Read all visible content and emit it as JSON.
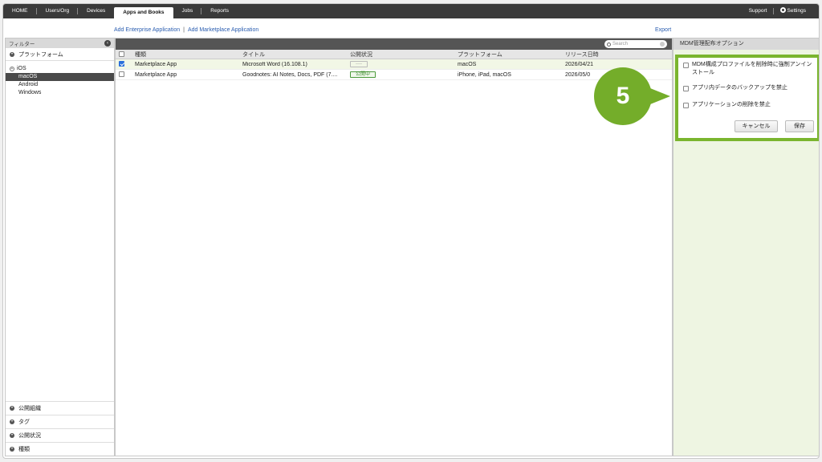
{
  "nav": {
    "items": [
      "HOME",
      "Users/Org",
      "Devices",
      "Apps and Books",
      "Jobs",
      "Reports"
    ],
    "support": "Support",
    "settings": "Settings"
  },
  "actions": {
    "add_enterprise": "Add Enterprise Application",
    "separator": "|",
    "add_marketplace": "Add Marketplace Application",
    "export": "Export"
  },
  "sidebar": {
    "filter_title": "フィルター",
    "platform_section": "プラットフォーム",
    "tree": [
      "iOS",
      "macOS",
      "Android",
      "Windows"
    ],
    "bottom_sections": [
      "公開組織",
      "タグ",
      "公開状況",
      "種類"
    ]
  },
  "table": {
    "search_placeholder": "Search",
    "headers": [
      "種類",
      "タイトル",
      "公開状況",
      "プラットフォーム",
      "リリース日時"
    ],
    "rows": [
      {
        "type": "Marketplace App",
        "title": "Microsoft Word (16.108.1)",
        "status": "----",
        "platform": "macOS",
        "release": "2026/04/21"
      },
      {
        "type": "Marketplace App",
        "title": "Goodnotes: AI Notes, Docs, PDF (7....",
        "status": "公開中",
        "platform": "iPhone, iPad, macOS",
        "release": "2026/05/0"
      }
    ]
  },
  "right_panel": {
    "title": "MDM管理配布オプション",
    "options": [
      "MDM構成プロファイルを削除時に強制アンインストール",
      "アプリ内データのバックアップを禁止",
      "アプリケーションの削除を禁止"
    ],
    "cancel": "キャンセル",
    "save": "保存"
  },
  "step_number": "5",
  "colors": {
    "accent_green": "#74ad2a",
    "nav_dark": "#3a3a3a",
    "link_blue": "#2a5db0"
  }
}
